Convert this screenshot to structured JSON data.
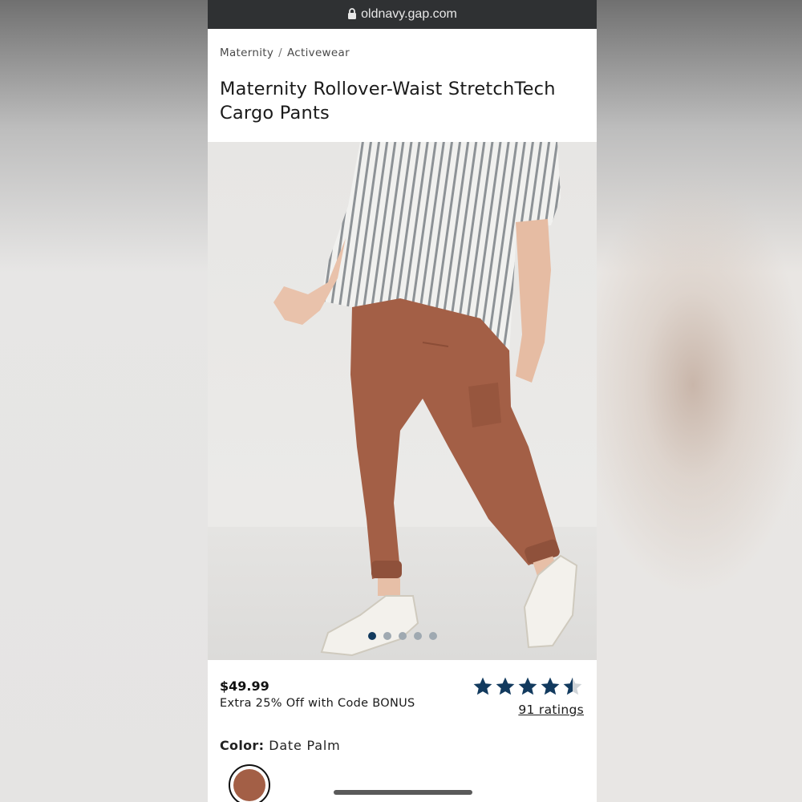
{
  "browser": {
    "url": "oldnavy.gap.com"
  },
  "breadcrumb": {
    "items": [
      "Maternity",
      "Activewear"
    ],
    "separator": "/"
  },
  "product": {
    "title": "Maternity Rollover-Waist StretchTech Cargo Pants",
    "price": "$49.99",
    "promo": "Extra 25% Off with Code BONUS",
    "rating": {
      "stars": 4.5,
      "max": 5,
      "count_label": "91 ratings"
    },
    "color": {
      "label": "Color:",
      "value": "Date Palm",
      "swatch_hex": "#a35f46"
    },
    "image_carousel": {
      "total": 5,
      "active_index": 0
    }
  },
  "colors": {
    "star_filled": "#123a5e",
    "star_empty": "#cfd4d8",
    "dot_active": "#123a5e",
    "dot_inactive": "#9fa9b1",
    "pants": "#a35f46"
  }
}
